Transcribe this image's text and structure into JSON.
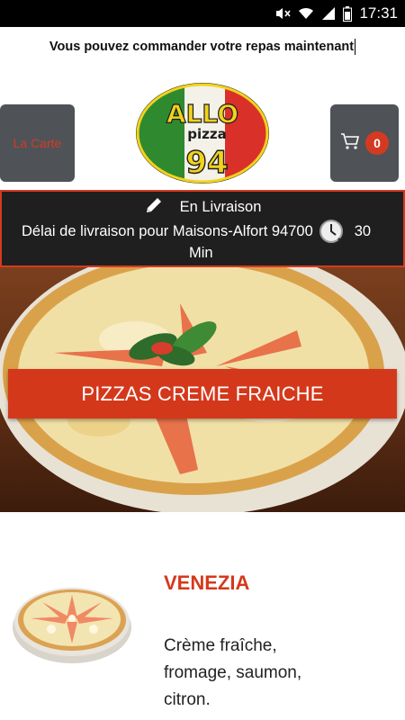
{
  "status_bar": {
    "time": "17:31"
  },
  "banner": {
    "text": "Vous pouvez commander votre repas maintenant"
  },
  "header": {
    "carte_label": "La Carte",
    "cart_count": "0",
    "logo": {
      "line1": "ALLO",
      "line2": "pizza",
      "line3": "94"
    }
  },
  "delivery": {
    "mode": "En Livraison",
    "delay_text": "Délai de livraison pour Maisons-Alfort 94700",
    "delay_value": "30",
    "delay_unit": "Min"
  },
  "category": {
    "title": "PIZZAS CREME FRAICHE"
  },
  "product": {
    "name": "VENEZIA",
    "description": "Crème fraîche, fromage, saumon, citron."
  },
  "colors": {
    "accent": "#d4381b",
    "button_bg": "#4f5357",
    "info_bg": "#1f1f1f"
  }
}
